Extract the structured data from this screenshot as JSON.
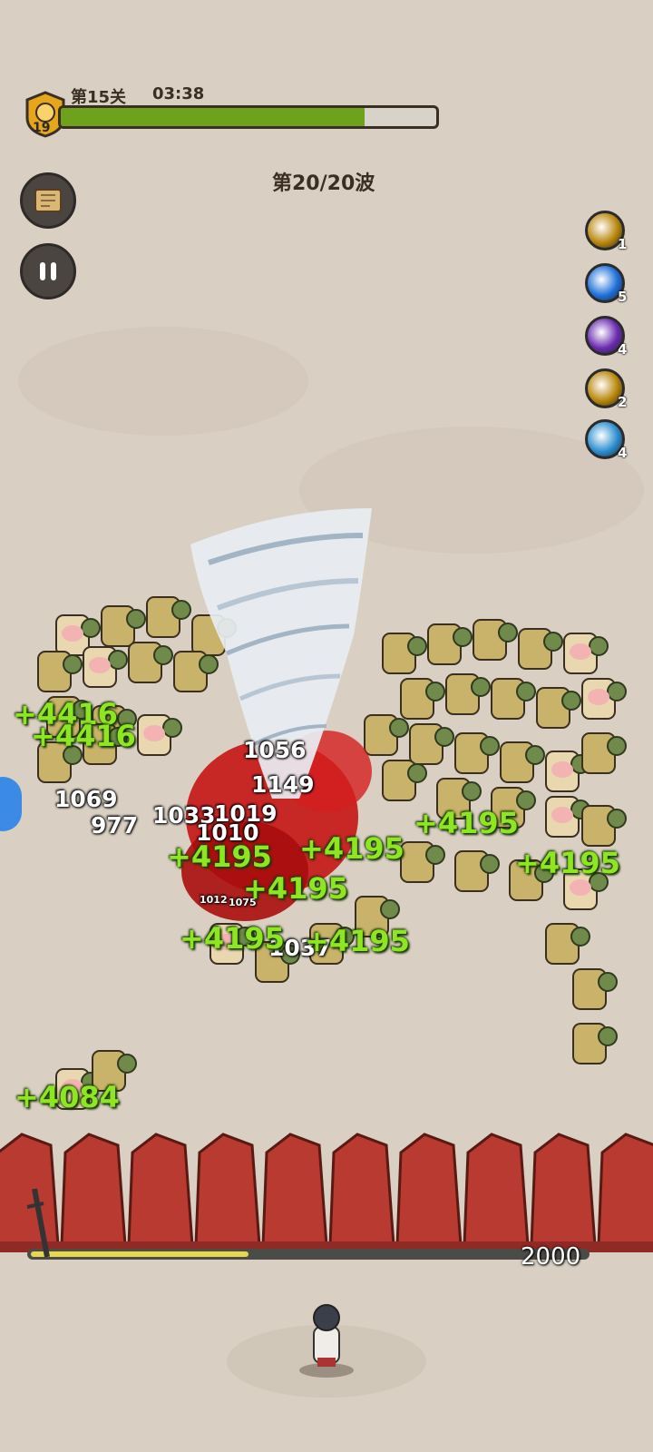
{
  "hud": {
    "level_label": "第15关",
    "timer": "03:38",
    "player_level": "19",
    "progress": 0.81,
    "wave_label": "第20/20波"
  },
  "skills": [
    {
      "name": "sword-skill-icon",
      "count": "1",
      "color": "#b8860b"
    },
    {
      "name": "ice-skill-icon",
      "count": "5",
      "color": "#1e6fd9"
    },
    {
      "name": "lightning-skill-icon",
      "count": "4",
      "color": "#6a2bb0"
    },
    {
      "name": "blade-skill-icon",
      "count": "2",
      "color": "#b8860b"
    },
    {
      "name": "wind-skill-icon",
      "count": "4",
      "color": "#2a8ecf"
    }
  ],
  "damage_numbers": [
    "1056",
    "1149",
    "1069",
    "977",
    "1033",
    "1019",
    "1010",
    "1037",
    "1012",
    "1075"
  ],
  "heal_numbers": [
    "+4416",
    "+4416",
    "+4195",
    "+4195",
    "+4195",
    "+4195",
    "+4195",
    "+4195",
    "+4195",
    "+4084"
  ],
  "wall": {
    "hp": "2000"
  },
  "colors": {
    "progress_fill": "#6ea21c",
    "heal_text": "#8ee522",
    "wall": "#b83a30",
    "ground": "#d9cfc2"
  }
}
